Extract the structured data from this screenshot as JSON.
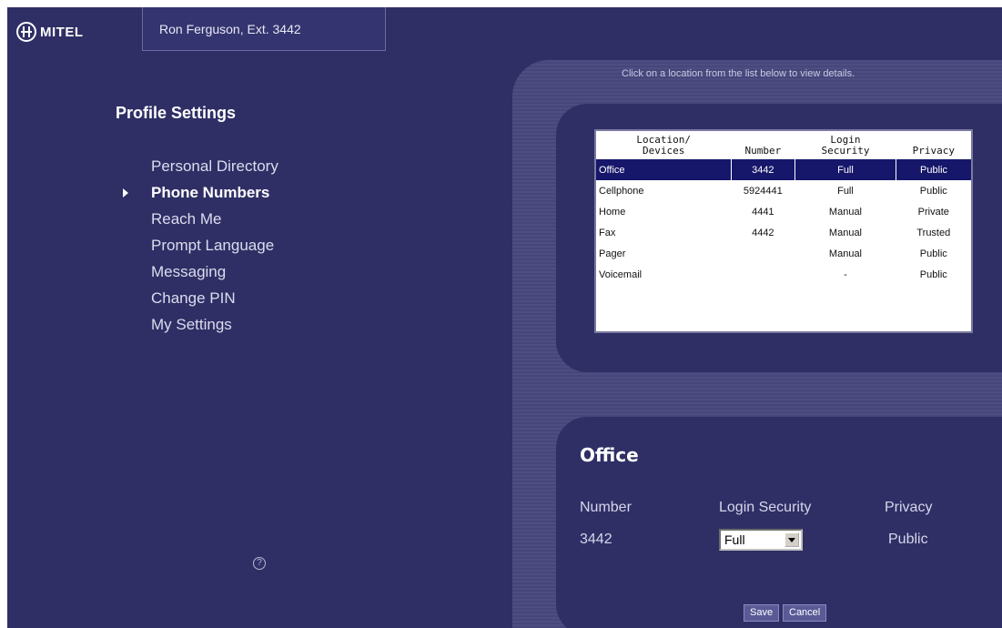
{
  "header": {
    "logo_text": "MITEL",
    "user_label": "Ron Ferguson, Ext. 3442"
  },
  "sidebar": {
    "title": "Profile Settings",
    "items": [
      {
        "label": "Personal Directory",
        "active": false
      },
      {
        "label": "Phone Numbers",
        "active": true
      },
      {
        "label": "Reach Me",
        "active": false
      },
      {
        "label": "Prompt Language",
        "active": false
      },
      {
        "label": "Messaging",
        "active": false
      },
      {
        "label": "Change PIN",
        "active": false
      },
      {
        "label": "My Settings",
        "active": false
      }
    ],
    "help_icon": "?"
  },
  "main": {
    "instructions": "Click on a location from the list below to view details.",
    "table": {
      "headers": [
        "Location/\nDevices",
        "Number",
        "Login\nSecurity",
        "Privacy"
      ],
      "rows": [
        {
          "location": "Office",
          "number": "3442",
          "login": "Full",
          "privacy": "Public",
          "selected": true
        },
        {
          "location": "Cellphone",
          "number": "5924441",
          "login": "Full",
          "privacy": "Public",
          "selected": false
        },
        {
          "location": "Home",
          "number": "4441",
          "login": "Manual",
          "privacy": "Private",
          "selected": false
        },
        {
          "location": "Fax",
          "number": "4442",
          "login": "Manual",
          "privacy": "Trusted",
          "selected": false
        },
        {
          "location": "Pager",
          "number": "",
          "login": "Manual",
          "privacy": "Public",
          "selected": false
        },
        {
          "location": "Voicemail",
          "number": "",
          "login": "-",
          "privacy": "Public",
          "selected": false
        }
      ]
    },
    "detail": {
      "title": "Office",
      "number_label": "Number",
      "number_value": "3442",
      "login_label": "Login Security",
      "login_value": "Full",
      "privacy_label": "Privacy",
      "privacy_value": "Public",
      "save_label": "Save",
      "cancel_label": "Cancel"
    }
  },
  "colors": {
    "background": "#2f2f66",
    "panel": "#4d4d82",
    "selected_row": "#16166a"
  }
}
